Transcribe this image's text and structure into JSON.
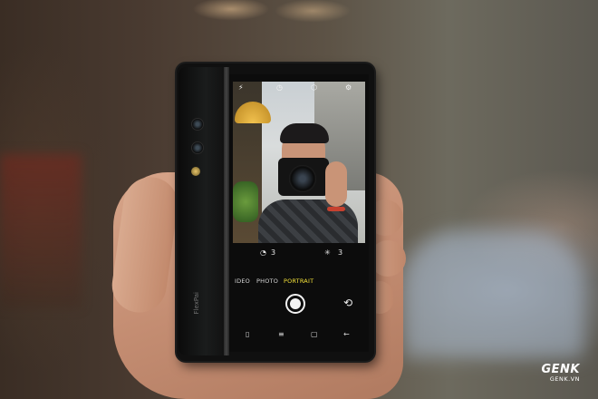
{
  "camera_ui": {
    "top_icons": [
      "flash-icon",
      "timer-icon",
      "filter-icon",
      "settings-icon"
    ],
    "bokeh_label_value": "3",
    "beauty_label_value": "3",
    "modes": [
      "IDEO",
      "PHOTO",
      "PORTRAIT"
    ],
    "active_mode": "PORTRAIT",
    "active_mode_color": "#f4e23a",
    "nav_icons": [
      "recents-icon",
      "menu-icon",
      "home-icon",
      "back-icon"
    ]
  },
  "phone": {
    "brand_text": "FlexPai"
  },
  "watermark": {
    "logo": "GENK",
    "site": "GENK.VN"
  }
}
